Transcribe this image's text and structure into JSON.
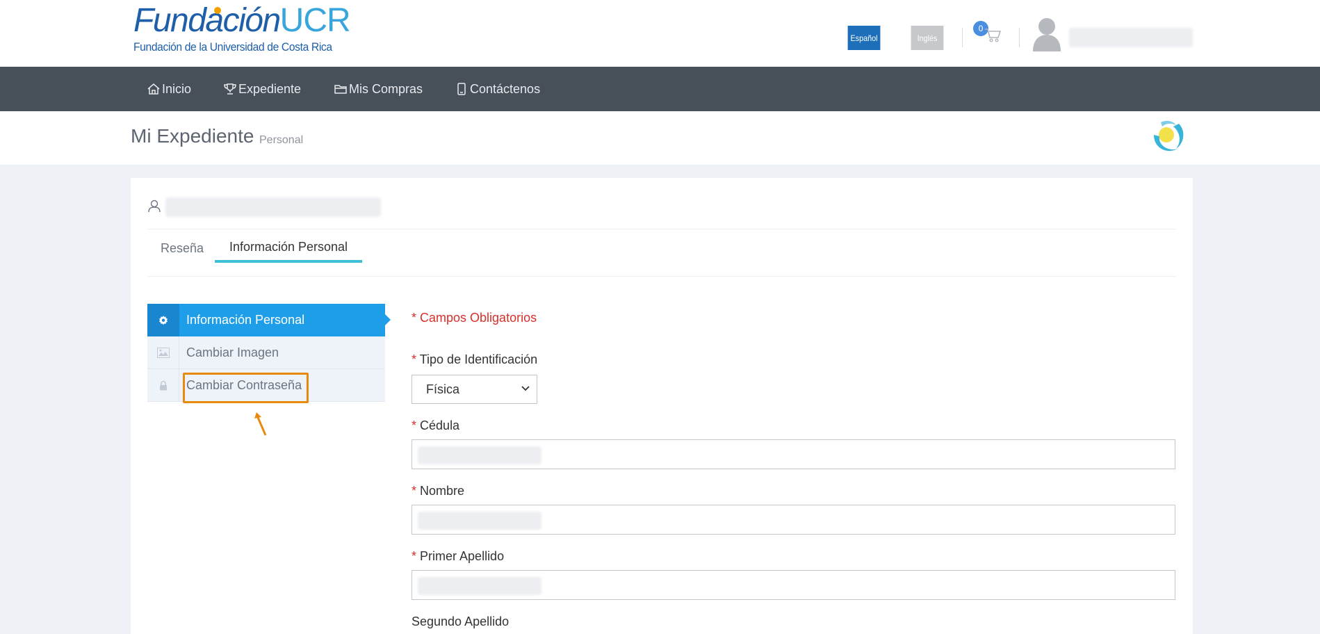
{
  "header": {
    "logo_brand": "Fundación",
    "logo_brand_ucr": "UCR",
    "logo_tagline": "Fundación de la Universidad de Costa Rica",
    "lang_spanish": "Español",
    "lang_english": "Inglés",
    "cart_count": "0",
    "icons": [
      "cart-icon",
      "avatar-icon"
    ]
  },
  "nav": {
    "items": [
      {
        "label": "Inicio",
        "icon": "home-icon"
      },
      {
        "label": "Expediente",
        "icon": "trophy-icon"
      },
      {
        "label": "Mis Compras",
        "icon": "folder-icon"
      },
      {
        "label": "Contáctenos",
        "icon": "phone-icon"
      }
    ]
  },
  "page": {
    "title": "Mi Expediente",
    "subtitle": "Personal"
  },
  "tabs": [
    {
      "label": "Reseña",
      "active": false
    },
    {
      "label": "Información Personal",
      "active": true
    }
  ],
  "side_menu": [
    {
      "label": "Información Personal",
      "icon": "gear-icon",
      "active": true
    },
    {
      "label": "Cambiar Imagen",
      "icon": "image-icon",
      "active": false
    },
    {
      "label": "Cambiar Contraseña",
      "icon": "lock-icon",
      "active": false
    }
  ],
  "form": {
    "required_note": "* Campos Obligatorios",
    "id_type_label": "Tipo de Identificación",
    "id_type_value": "Física",
    "cedula_label": "Cédula",
    "nombre_label": "Nombre",
    "primer_apellido_label": "Primer Apellido",
    "segundo_apellido_label": "Segundo Apellido",
    "required_mark": "*"
  },
  "colors": {
    "nav_bg": "#474f58",
    "accent_blue": "#1e9ee8",
    "tab_underline": "#3fc0d9",
    "required_red": "#d9302b",
    "highlight_orange": "#e88a0e"
  }
}
